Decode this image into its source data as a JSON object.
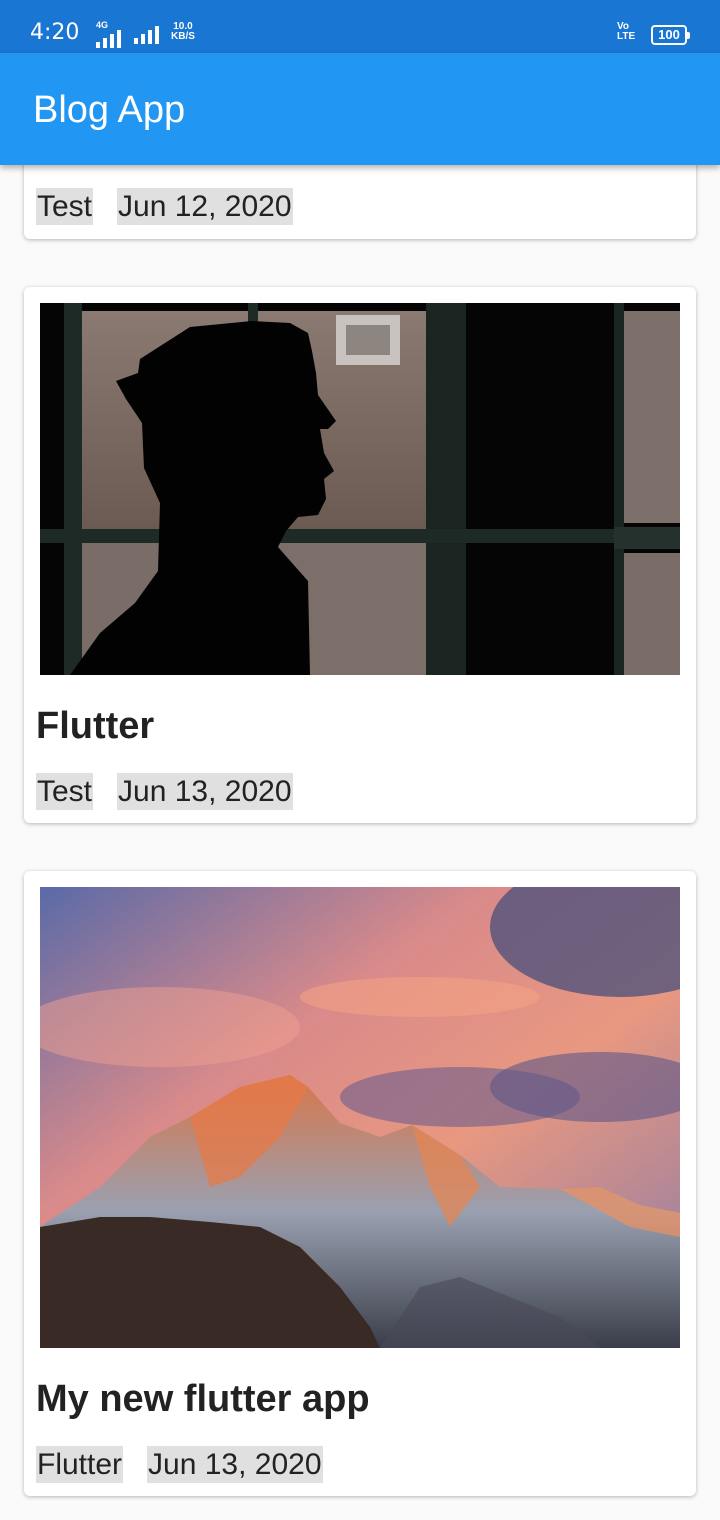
{
  "status_bar": {
    "time": "4:20",
    "network_type": "4G",
    "speed_value": "10.0",
    "speed_unit": "KB/S",
    "volte_line1": "Vo",
    "volte_line2": "LTE",
    "battery": "100"
  },
  "app_bar": {
    "title": "Blog App"
  },
  "posts": [
    {
      "title": "",
      "author": "Test",
      "date": "Jun 12, 2020",
      "image": "none-visible"
    },
    {
      "title": "Flutter",
      "author": "Test",
      "date": "Jun 13, 2020",
      "image": "silhouette-officer-window-image"
    },
    {
      "title": "My new flutter app",
      "author": "Flutter",
      "date": "Jun 13, 2020",
      "image": "mountain-sunset-image"
    }
  ],
  "colors": {
    "status_bar": "#1976D2",
    "app_bar": "#2196F3",
    "chip_background": "#e0e0e0",
    "page_background": "#fafafa"
  }
}
